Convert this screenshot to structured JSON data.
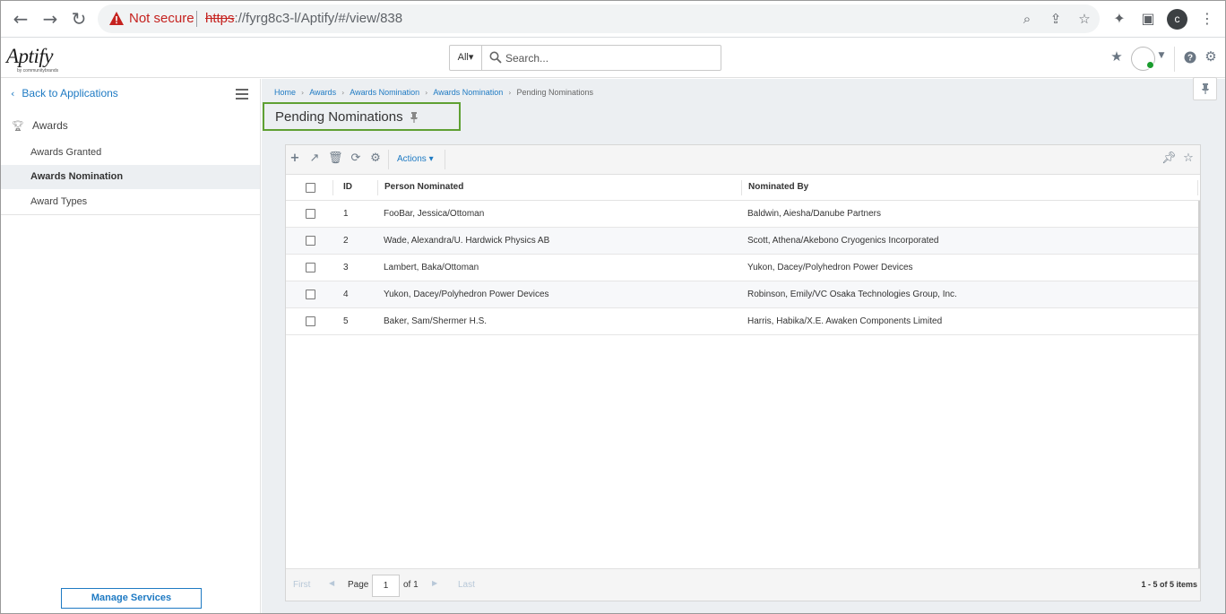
{
  "browser": {
    "security_label": "Not secure",
    "url_scheme": "https",
    "url_rest": "://fyrg8c3-l/Aptify/#/view/838",
    "profile_initial": "c",
    "icons": [
      "back-arrow-icon",
      "forward-arrow-icon",
      "reload-icon",
      "warning-icon",
      "zoom-icon",
      "share-icon",
      "bookmark-star-icon",
      "extensions-icon",
      "side-panel-icon",
      "kebab-menu-icon"
    ]
  },
  "header": {
    "logo_text": "Aptify",
    "logo_sub": "by communitybrands",
    "search_scope": "All▾",
    "search_placeholder": "Search...",
    "accent_color": "#1e7ac3",
    "status_color": "#1a9c2e"
  },
  "sidebar": {
    "back_label": "Back to Applications",
    "group_label": "Awards",
    "items": [
      {
        "label": "Awards Granted",
        "active": false
      },
      {
        "label": "Awards Nomination",
        "active": true
      },
      {
        "label": "Award Types",
        "active": false
      }
    ],
    "manage_label": "Manage Services"
  },
  "main": {
    "breadcrumb": [
      {
        "label": "Home",
        "link": true
      },
      {
        "label": "Awards",
        "link": true
      },
      {
        "label": "Awards Nomination",
        "link": true
      },
      {
        "label": "Awards Nomination",
        "link": true
      },
      {
        "label": "Pending Nominations",
        "link": false
      }
    ],
    "title": "Pending Nominations",
    "title_highlight_color": "#5fa033",
    "toolbar": {
      "actions_label": "Actions ▾"
    },
    "grid": {
      "columns": [
        "ID",
        "Person Nominated",
        "Nominated By"
      ],
      "rows": [
        {
          "id": "1",
          "person": "FooBar, Jessica/Ottoman",
          "by": "Baldwin, Aiesha/Danube Partners"
        },
        {
          "id": "2",
          "person": "Wade, Alexandra/U. Hardwick Physics AB",
          "by": "Scott, Athena/Akebono Cryogenics Incorporated"
        },
        {
          "id": "3",
          "person": "Lambert, Baka/Ottoman",
          "by": "Yukon, Dacey/Polyhedron Power Devices"
        },
        {
          "id": "4",
          "person": "Yukon, Dacey/Polyhedron Power Devices",
          "by": "Robinson, Emily/VC Osaka Technologies Group, Inc."
        },
        {
          "id": "5",
          "person": "Baker, Sam/Shermer H.S.",
          "by": "Harris, Habika/X.E. Awaken Components Limited"
        }
      ]
    },
    "pager": {
      "first": "First",
      "page_label": "Page",
      "page_value": "1",
      "of_label": "of 1",
      "last": "Last",
      "info": "1 - 5 of 5 items"
    }
  }
}
